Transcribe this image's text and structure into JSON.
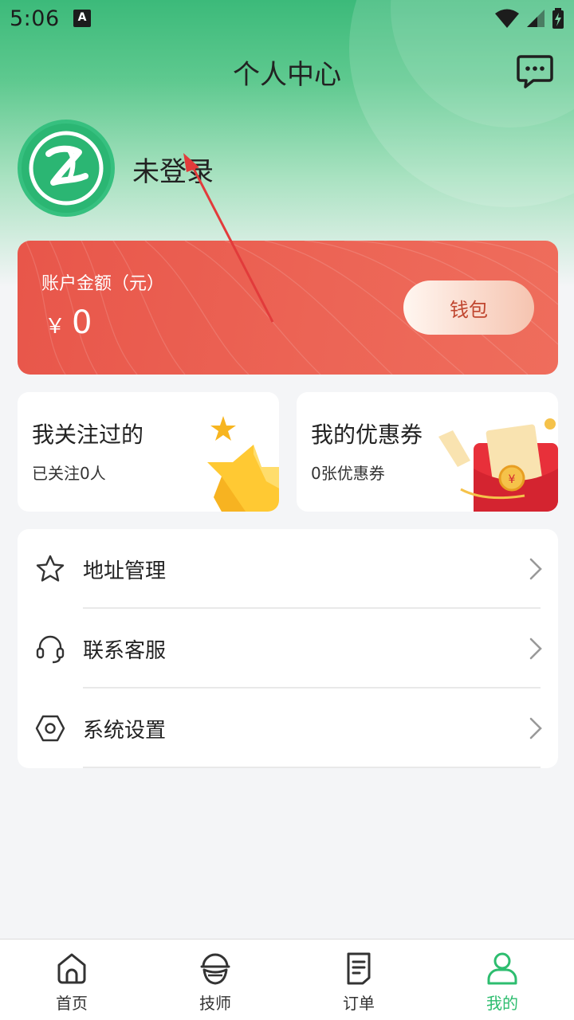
{
  "status_bar": {
    "time": "5:06",
    "notification_letter": "A"
  },
  "header": {
    "title": "个人中心",
    "message_icon": "chat-bubble-icon"
  },
  "profile": {
    "login_status": "未登录",
    "avatar_icon": "brand-logo-icon"
  },
  "wallet": {
    "label": "账户金额（元）",
    "currency": "￥",
    "amount": "0",
    "button_label": "钱包",
    "colors": {
      "card": "#e8564a",
      "button_text": "#c0462f"
    }
  },
  "cards": {
    "follow": {
      "title": "我关注过的",
      "subtitle": "已关注0人",
      "icon": "star-illustration-icon"
    },
    "coupon": {
      "title": "我的优惠券",
      "subtitle": "0张优惠券",
      "icon": "red-envelope-illustration-icon"
    }
  },
  "menu": [
    {
      "label": "地址管理",
      "icon": "star-outline-icon"
    },
    {
      "label": "联系客服",
      "icon": "headset-icon"
    },
    {
      "label": "系统设置",
      "icon": "hexagon-settings-icon"
    }
  ],
  "tabbar": {
    "active_color": "#2dbd6f",
    "items": [
      {
        "label": "首页",
        "icon": "home-icon"
      },
      {
        "label": "技师",
        "icon": "technician-icon"
      },
      {
        "label": "订单",
        "icon": "order-document-icon"
      },
      {
        "label": "我的",
        "icon": "user-icon",
        "active": true
      }
    ]
  },
  "theme": {
    "primary_green": "#3cba7a",
    "background": "#f4f5f7"
  }
}
